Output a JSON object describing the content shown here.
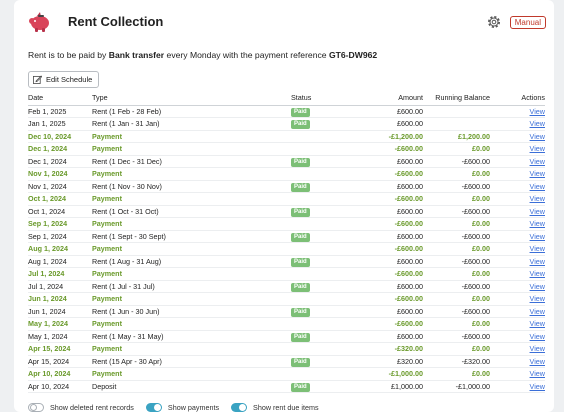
{
  "header": {
    "title": "Rent Collection",
    "manual_badge": "Manual"
  },
  "intro": {
    "prefix": "Rent is to be paid by",
    "method": "Bank transfer",
    "middle": "every Monday with the payment reference",
    "reference": "GT6-DW962"
  },
  "edit_button": {
    "label": "Edit Schedule"
  },
  "table": {
    "headers": {
      "date": "Date",
      "type": "Type",
      "status": "Status",
      "amount": "Amount",
      "balance": "Running Balance",
      "actions": "Actions"
    },
    "rows": [
      {
        "kind": "rent",
        "date": "Feb 1, 2025",
        "type": "Rent (1 Feb - 28 Feb)",
        "status": "Paid",
        "amount": "£600.00",
        "balance": "",
        "action": "View"
      },
      {
        "kind": "rent",
        "date": "Jan 1, 2025",
        "type": "Rent (1 Jan - 31 Jan)",
        "status": "Paid",
        "amount": "£600.00",
        "balance": "",
        "action": "View"
      },
      {
        "kind": "pay",
        "date": "Dec 10, 2024",
        "type": "Payment",
        "status": "",
        "amount": "-£1,200.00",
        "balance": "£1,200.00",
        "action": "View"
      },
      {
        "kind": "pay",
        "date": "Dec 1, 2024",
        "type": "Payment",
        "status": "",
        "amount": "-£600.00",
        "balance": "£0.00",
        "action": "View"
      },
      {
        "kind": "rent",
        "date": "Dec 1, 2024",
        "type": "Rent (1 Dec - 31 Dec)",
        "status": "Paid",
        "amount": "£600.00",
        "balance": "-£600.00",
        "action": "View"
      },
      {
        "kind": "pay",
        "date": "Nov 1, 2024",
        "type": "Payment",
        "status": "",
        "amount": "-£600.00",
        "balance": "£0.00",
        "action": "View"
      },
      {
        "kind": "rent",
        "date": "Nov 1, 2024",
        "type": "Rent (1 Nov - 30 Nov)",
        "status": "Paid",
        "amount": "£600.00",
        "balance": "-£600.00",
        "action": "View"
      },
      {
        "kind": "pay",
        "date": "Oct 1, 2024",
        "type": "Payment",
        "status": "",
        "amount": "-£600.00",
        "balance": "£0.00",
        "action": "View"
      },
      {
        "kind": "rent",
        "date": "Oct 1, 2024",
        "type": "Rent (1 Oct - 31 Oct)",
        "status": "Paid",
        "amount": "£600.00",
        "balance": "-£600.00",
        "action": "View"
      },
      {
        "kind": "pay",
        "date": "Sep 1, 2024",
        "type": "Payment",
        "status": "",
        "amount": "-£600.00",
        "balance": "£0.00",
        "action": "View"
      },
      {
        "kind": "rent",
        "date": "Sep 1, 2024",
        "type": "Rent (1 Sept - 30 Sept)",
        "status": "Paid",
        "amount": "£600.00",
        "balance": "-£600.00",
        "action": "View"
      },
      {
        "kind": "pay",
        "date": "Aug 1, 2024",
        "type": "Payment",
        "status": "",
        "amount": "-£600.00",
        "balance": "£0.00",
        "action": "View"
      },
      {
        "kind": "rent",
        "date": "Aug 1, 2024",
        "type": "Rent (1 Aug - 31 Aug)",
        "status": "Paid",
        "amount": "£600.00",
        "balance": "-£600.00",
        "action": "View"
      },
      {
        "kind": "pay",
        "date": "Jul 1, 2024",
        "type": "Payment",
        "status": "",
        "amount": "-£600.00",
        "balance": "£0.00",
        "action": "View"
      },
      {
        "kind": "rent",
        "date": "Jul 1, 2024",
        "type": "Rent (1 Jul - 31 Jul)",
        "status": "Paid",
        "amount": "£600.00",
        "balance": "-£600.00",
        "action": "View"
      },
      {
        "kind": "pay",
        "date": "Jun 1, 2024",
        "type": "Payment",
        "status": "",
        "amount": "-£600.00",
        "balance": "£0.00",
        "action": "View"
      },
      {
        "kind": "rent",
        "date": "Jun 1, 2024",
        "type": "Rent (1 Jun - 30 Jun)",
        "status": "Paid",
        "amount": "£600.00",
        "balance": "-£600.00",
        "action": "View"
      },
      {
        "kind": "pay",
        "date": "May 1, 2024",
        "type": "Payment",
        "status": "",
        "amount": "-£600.00",
        "balance": "£0.00",
        "action": "View"
      },
      {
        "kind": "rent",
        "date": "May 1, 2024",
        "type": "Rent (1 May - 31 May)",
        "status": "Paid",
        "amount": "£600.00",
        "balance": "-£600.00",
        "action": "View"
      },
      {
        "kind": "pay",
        "date": "Apr 15, 2024",
        "type": "Payment",
        "status": "",
        "amount": "-£320.00",
        "balance": "£0.00",
        "action": "View"
      },
      {
        "kind": "rent",
        "date": "Apr 15, 2024",
        "type": "Rent (15 Apr - 30 Apr)",
        "status": "Paid",
        "amount": "£320.00",
        "balance": "-£320.00",
        "action": "View"
      },
      {
        "kind": "pay",
        "date": "Apr 10, 2024",
        "type": "Payment",
        "status": "",
        "amount": "-£1,000.00",
        "balance": "£0.00",
        "action": "View"
      },
      {
        "kind": "rent",
        "date": "Apr 10, 2024",
        "type": "Deposit",
        "status": "Paid",
        "amount": "£1,000.00",
        "balance": "-£1,000.00",
        "action": "View"
      }
    ]
  },
  "toggles": [
    {
      "label": "Show deleted rent records",
      "on": false
    },
    {
      "label": "Show payments",
      "on": true
    },
    {
      "label": "Show rent due items",
      "on": true
    }
  ],
  "colors": {
    "payment_text": "#6a9a2b",
    "paid_badge": "#7cbf76",
    "link": "#3b6fd8",
    "toggle_on": "#3aa3c2",
    "manual_badge": "#c0392b",
    "pig": "#d9445a"
  },
  "icons": {
    "title": "piggy-bank-icon",
    "settings": "gear-icon",
    "edit": "pencil-icon"
  }
}
